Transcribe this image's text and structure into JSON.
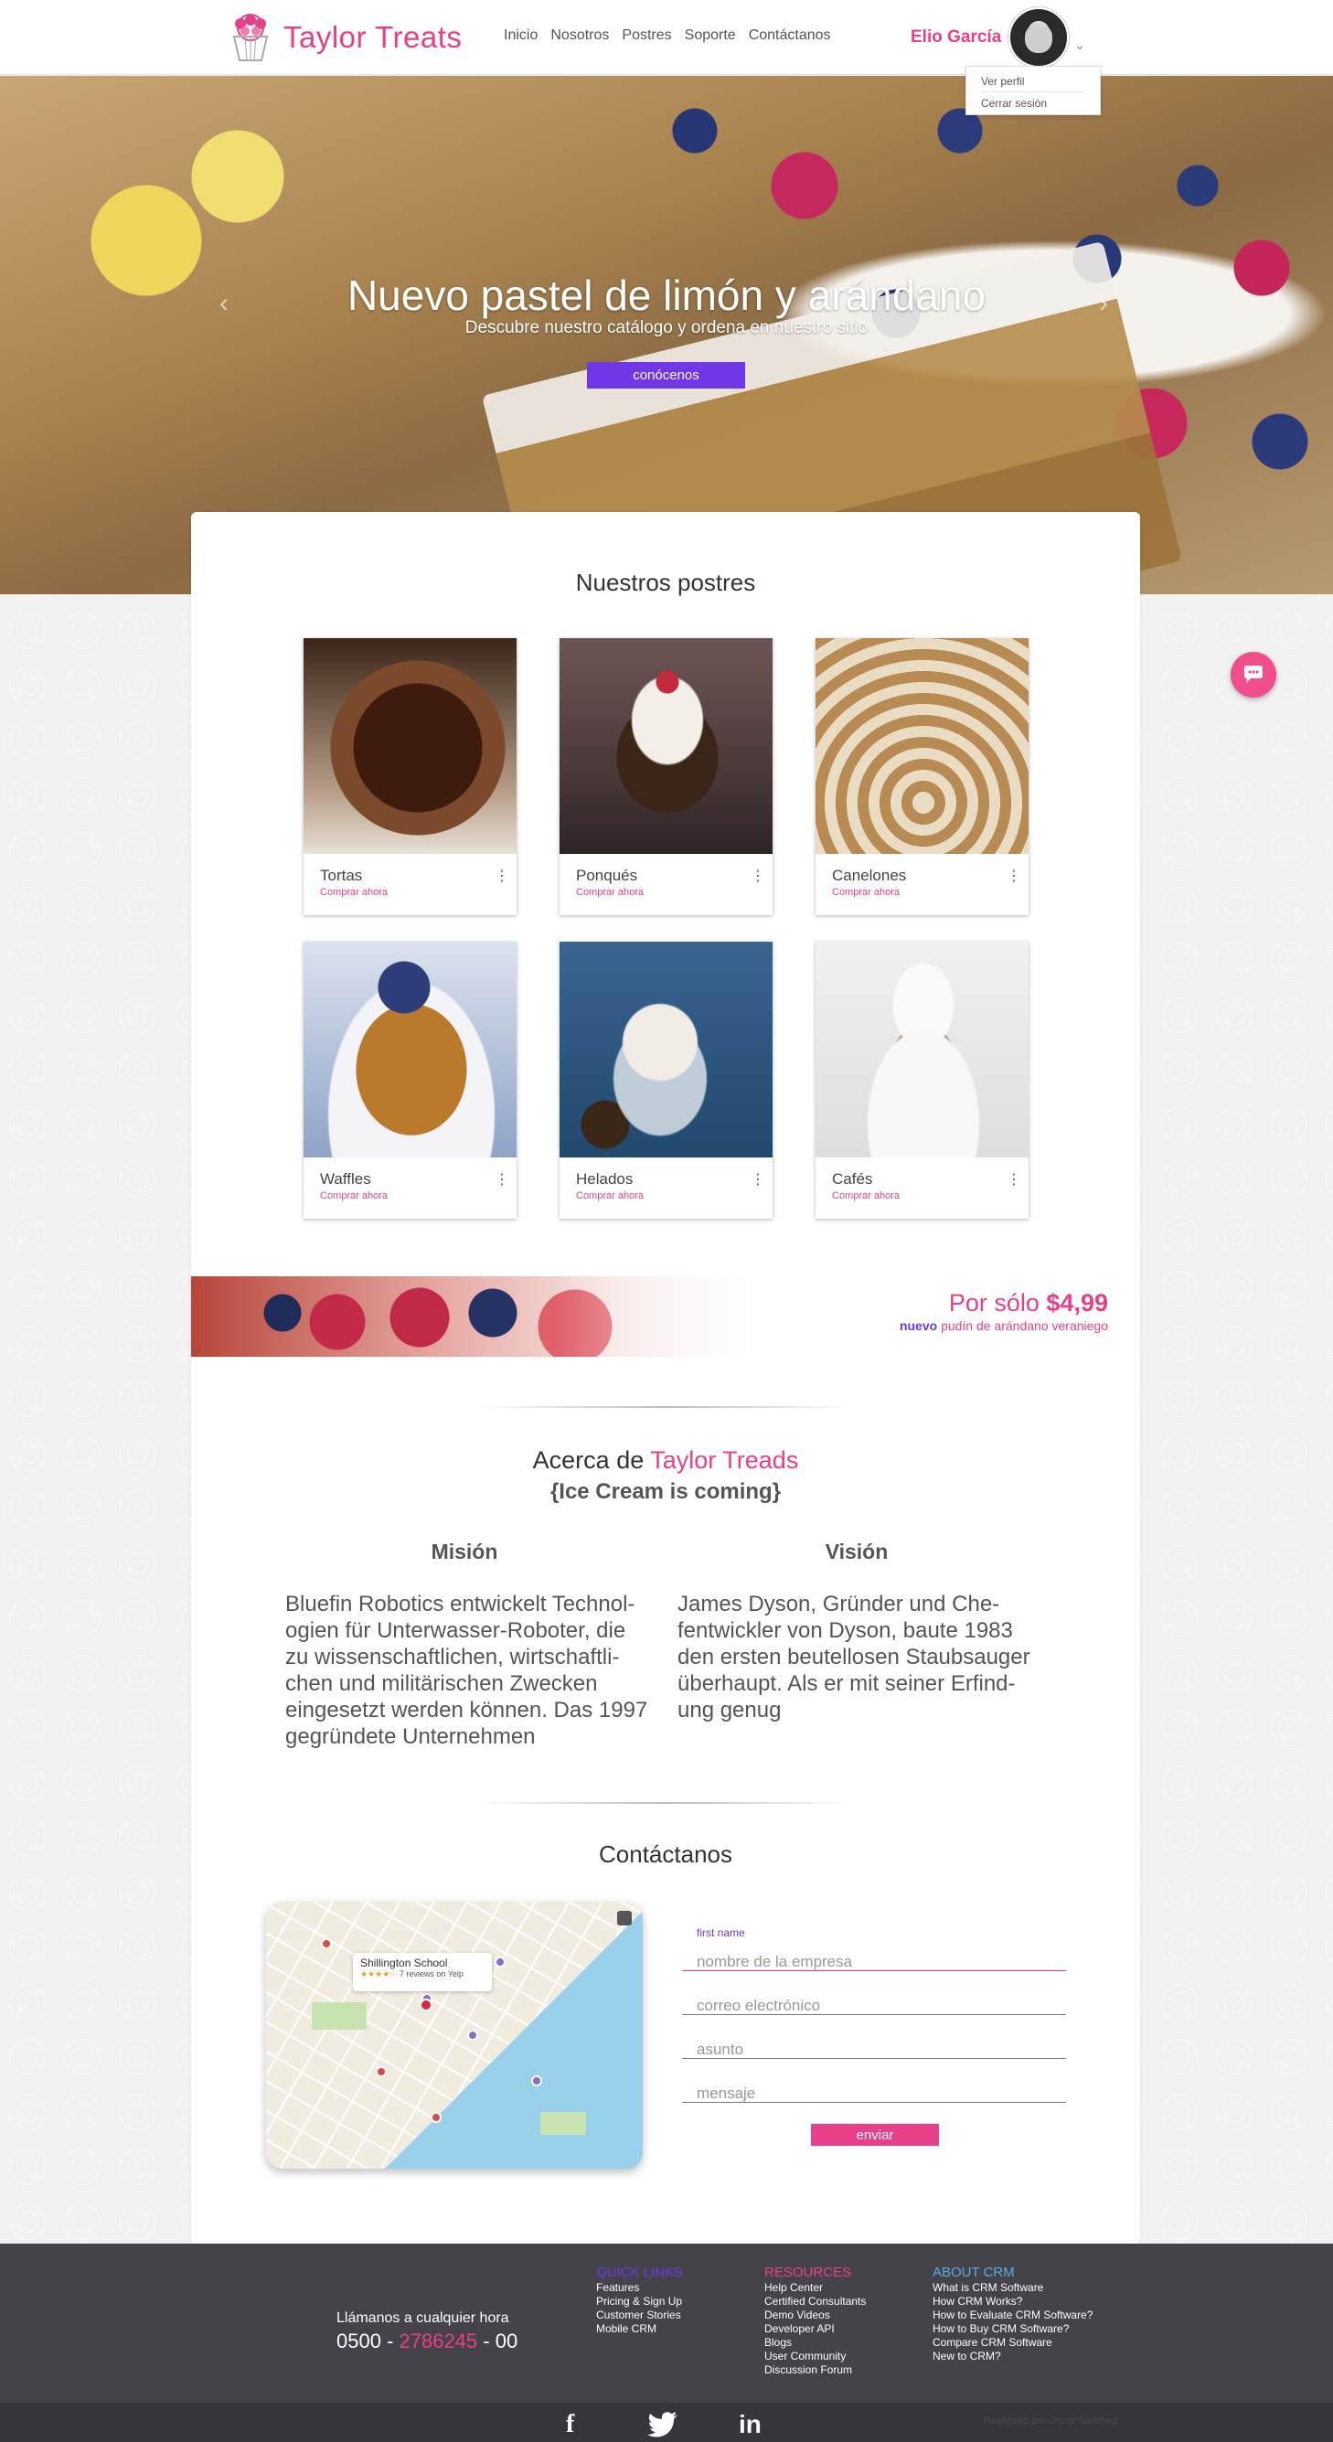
{
  "header": {
    "brand": "Taylor Treats",
    "nav": [
      "Inicio",
      "Nosotros",
      "Postres",
      "Soporte",
      "Contáctanos"
    ],
    "user_name": "Elio García",
    "user_menu": [
      "Ver perfil",
      "Cerrar sesión"
    ]
  },
  "hero": {
    "title": "Nuevo pastel de limón y arándano",
    "subtitle": "Descubre nuestro catálogo y ordena en nuestro sitio",
    "button": "conócenos"
  },
  "desserts": {
    "title": "Nuestros postres",
    "cta": "Comprar ahora",
    "items": [
      {
        "name": "Tortas"
      },
      {
        "name": "Ponqués"
      },
      {
        "name": "Canelones"
      },
      {
        "name": "Waffles"
      },
      {
        "name": "Helados"
      },
      {
        "name": "Cafés"
      }
    ]
  },
  "promo": {
    "price_prefix": "Por sólo",
    "price": "$4,99",
    "highlight": "nuevo",
    "description": "pudín de arándano veraniego"
  },
  "about": {
    "title_prefix": "Acerca de",
    "brand": "Taylor Treads",
    "subtitle": "{Ice Cream is coming}",
    "mission_title": "Misión",
    "mission_text": "Bluefin Robotics entwickelt Technol-ogien für Unterwasser-Roboter, die zu wissenschaftlichen, wirtschaftli-chen und militärischen Zwecken eingesetzt werden können. Das 1997 gegründete Unternehmen",
    "vision_title": "Visión",
    "vision_text": "James Dyson, Gründer und Che-fentwickler von Dyson, baute 1983 den ersten beutellosen Staubsauger überhaupt. Als er mit seiner Erfind-ung genug"
  },
  "contact": {
    "title": "Contáctanos",
    "map_place": "Shillington School",
    "map_reviews": "7 reviews on Yelp",
    "field_label": "first name",
    "fields": [
      "nombre de la empresa",
      "correo electrónico",
      "asunto",
      "mensaje"
    ],
    "send": "enviar"
  },
  "footer": {
    "call_label": "Llámanos a cualquier hora",
    "phone_a": "0500 - ",
    "phone_b": "2786245",
    "phone_c": " - 00",
    "quick_links": {
      "title": "QUICK LINKS",
      "color": "#6f37e8",
      "items": [
        "Features",
        "Pricing & Sign Up",
        "Customer Stories",
        "Mobile CRM"
      ]
    },
    "resources": {
      "title": "RESOURCES",
      "color": "#e83f8a",
      "items": [
        "Help Center",
        "Certified Consultants",
        "Demo Videos",
        "Developer API",
        "Blogs",
        "User Community",
        "Discussion Forum"
      ]
    },
    "about_crm": {
      "title": "ABOUT CRM",
      "color": "#5aa9e6",
      "items": [
        "What is CRM Software",
        "How CRM Works?",
        "How to Evaluate CRM Software?",
        "How to Buy CRM Software?",
        "Compare CRM Software",
        "New to CRM?"
      ]
    },
    "social": [
      "facebook-icon",
      "twitter-icon",
      "linkedin-icon"
    ],
    "copyright": "Realizado por Oscar Sánchez"
  },
  "colors": {
    "brand_pink": "#e83f8a",
    "accent_purple": "#6f37e8",
    "footer_bg": "#44434a"
  }
}
